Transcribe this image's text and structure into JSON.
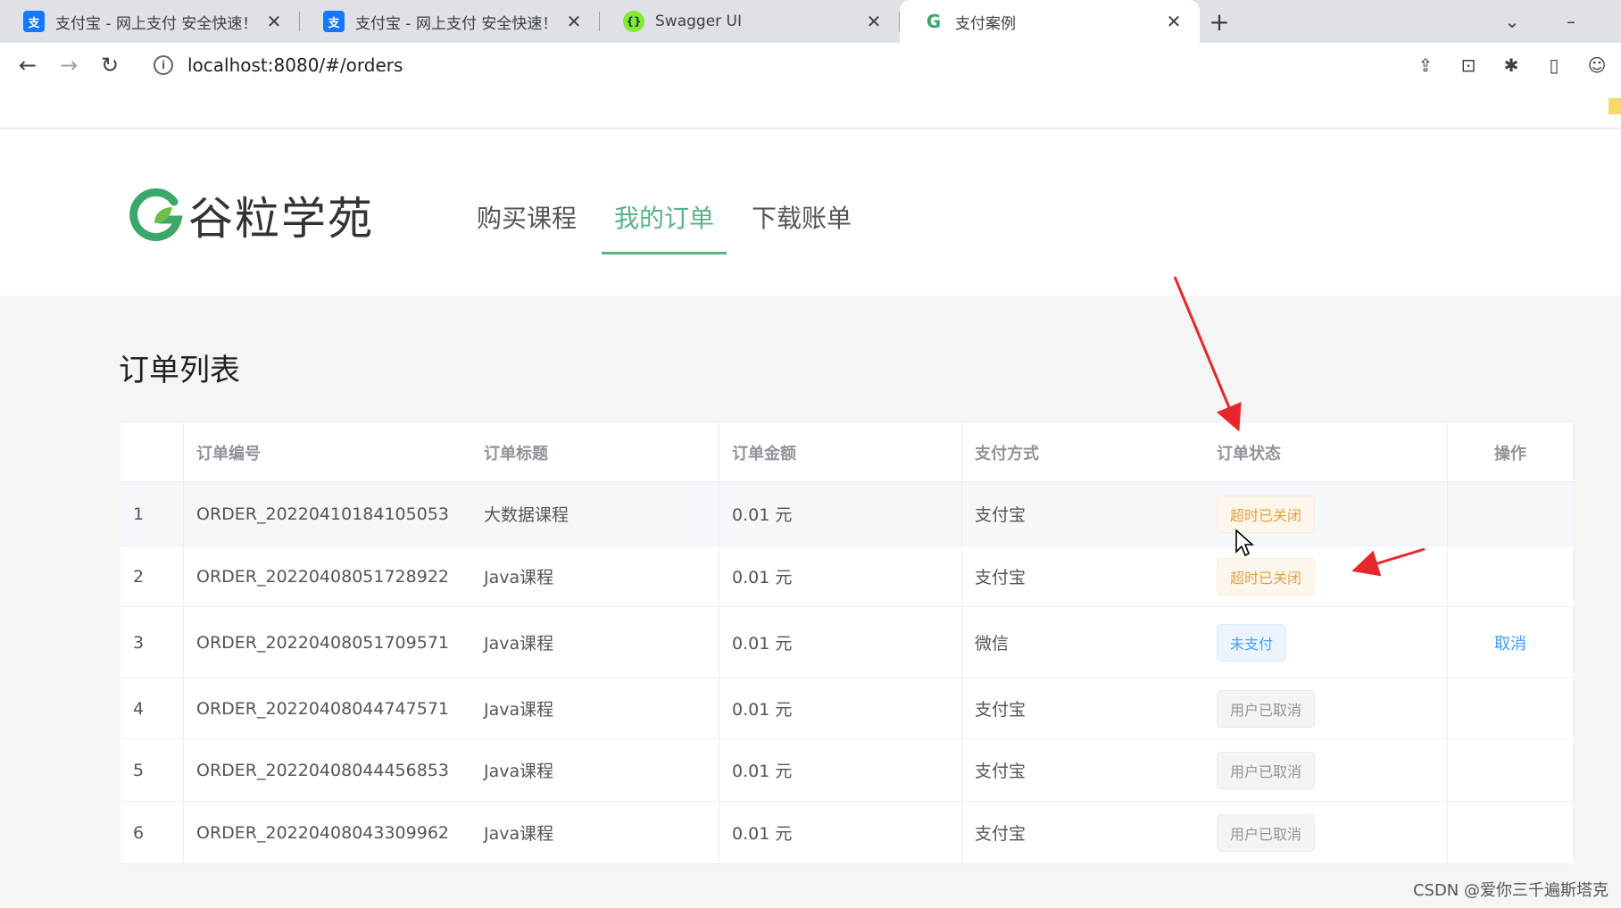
{
  "browser": {
    "tabs": [
      {
        "title": "支付宝 - 网上支付 安全快速！",
        "favicon": "alipay-icon",
        "favicon_char": "支",
        "active": false
      },
      {
        "title": "支付宝 - 网上支付 安全快速！",
        "favicon": "alipay-icon",
        "favicon_char": "支",
        "active": false
      },
      {
        "title": "Swagger UI",
        "favicon": "swagger-icon",
        "favicon_char": "{}",
        "active": false
      },
      {
        "title": "支付案例",
        "favicon": "guli-logo-icon",
        "favicon_char": "G",
        "active": true
      }
    ],
    "url": "localhost:8080/#/orders"
  },
  "site": {
    "logo_text": "谷粒学苑",
    "nav": [
      {
        "label": "购买课程",
        "active": false
      },
      {
        "label": "我的订单",
        "active": true
      },
      {
        "label": "下载账单",
        "active": false
      }
    ]
  },
  "orders": {
    "title": "订单列表",
    "columns": [
      "",
      "订单编号",
      "订单标题",
      "订单金额",
      "支付方式",
      "订单状态",
      "操作"
    ],
    "rows": [
      {
        "index": "1",
        "order_no": "ORDER_20220410184105053",
        "title": "大数据课程",
        "amount": "0.01 元",
        "payment": "支付宝",
        "status": "超时已关闭",
        "status_type": "warning",
        "action": ""
      },
      {
        "index": "2",
        "order_no": "ORDER_20220408051728922",
        "title": "Java课程",
        "amount": "0.01 元",
        "payment": "支付宝",
        "status": "超时已关闭",
        "status_type": "warning",
        "action": ""
      },
      {
        "index": "3",
        "order_no": "ORDER_20220408051709571",
        "title": "Java课程",
        "amount": "0.01 元",
        "payment": "微信",
        "status": "未支付",
        "status_type": "primary",
        "action": "取消"
      },
      {
        "index": "4",
        "order_no": "ORDER_20220408044747571",
        "title": "Java课程",
        "amount": "0.01 元",
        "payment": "支付宝",
        "status": "用户已取消",
        "status_type": "info",
        "action": ""
      },
      {
        "index": "5",
        "order_no": "ORDER_20220408044456853",
        "title": "Java课程",
        "amount": "0.01 元",
        "payment": "支付宝",
        "status": "用户已取消",
        "status_type": "info",
        "action": ""
      },
      {
        "index": "6",
        "order_no": "ORDER_20220408043309962",
        "title": "Java课程",
        "amount": "0.01 元",
        "payment": "支付宝",
        "status": "用户已取消",
        "status_type": "info",
        "action": ""
      }
    ]
  },
  "watermark": "CSDN @爱你三千遍斯塔克",
  "colors": {
    "brand_green": "#56b486",
    "annotation_red": "#e8262c",
    "link_blue": "#409eff"
  }
}
